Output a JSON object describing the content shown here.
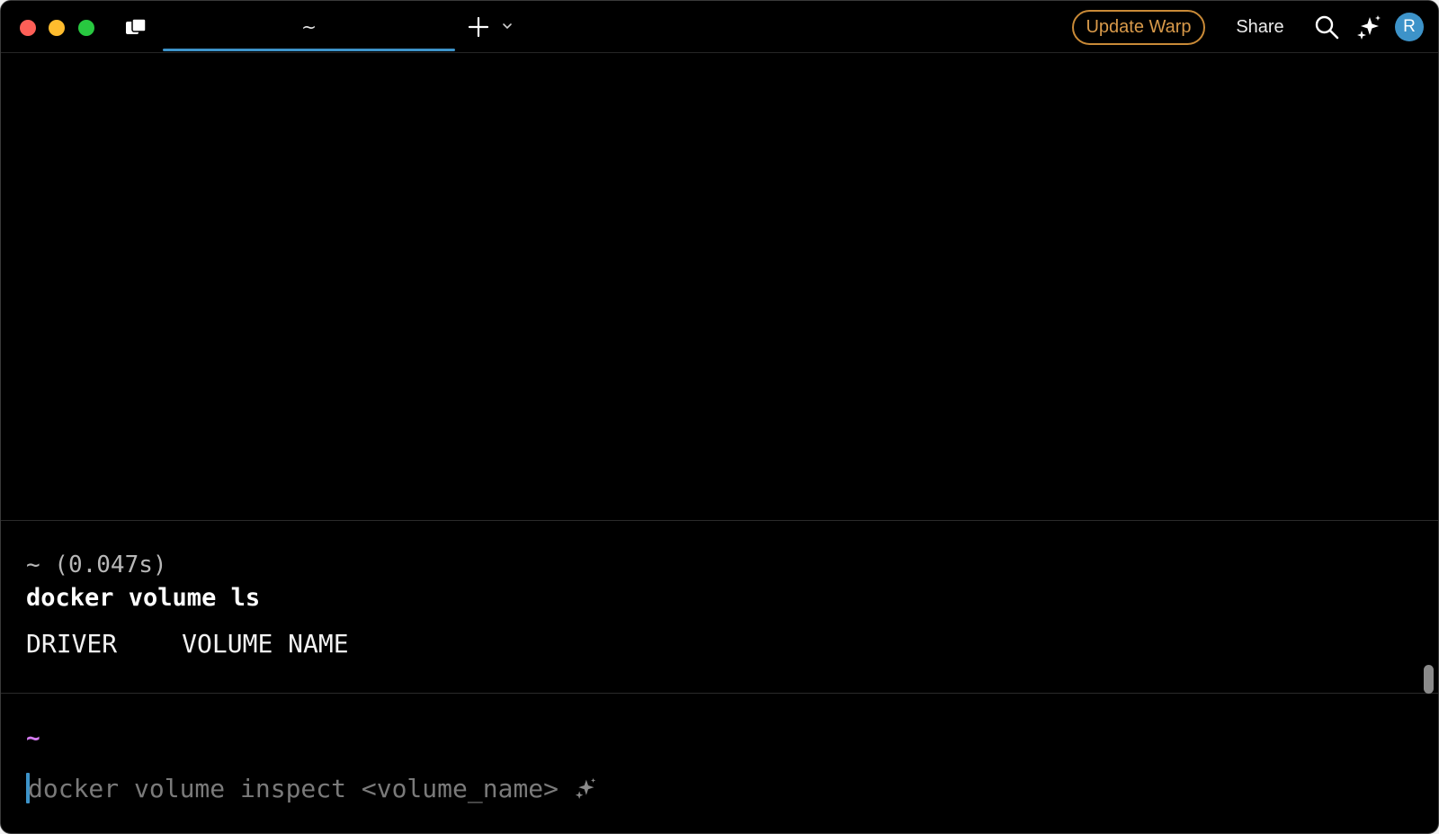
{
  "titlebar": {
    "tab_label": "~",
    "update_label": "Update Warp",
    "share_label": "Share",
    "avatar_initial": "R",
    "accent": "#3d93c9",
    "update_color": "#c98a37"
  },
  "block": {
    "meta": "~ (0.047s)",
    "command": "docker volume ls",
    "output_columns": [
      "DRIVER",
      "VOLUME NAME"
    ]
  },
  "prompt": {
    "directory": "~",
    "ghost_suggestion": "docker volume inspect <volume_name>",
    "dir_color": "#d57bf0"
  },
  "icons": [
    "panel-icon",
    "plus-icon",
    "chevron-down-icon",
    "search-icon",
    "ai-sparkle-icon"
  ]
}
